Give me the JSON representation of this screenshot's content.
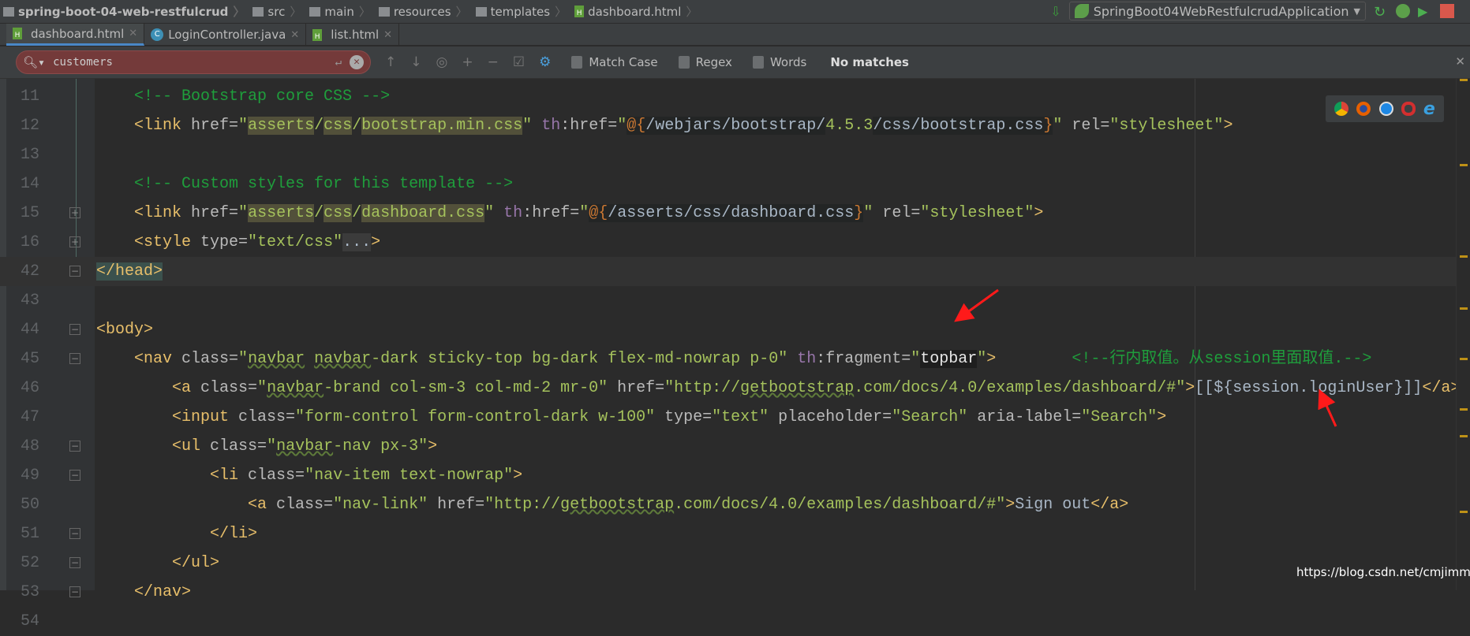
{
  "breadcrumb": [
    "spring-boot-04-web-restfulcrud",
    "src",
    "main",
    "resources",
    "templates",
    "dashboard.html"
  ],
  "run_config": "SpringBoot04WebRestfulcrudApplication",
  "tabs": [
    {
      "label": "dashboard.html",
      "icon": "html-file-icon",
      "active": true
    },
    {
      "label": "LoginController.java",
      "icon": "java-class-icon"
    },
    {
      "label": "list.html",
      "icon": "html-file-icon"
    }
  ],
  "find": {
    "query": "customers",
    "match_case": "Match Case",
    "regex": "Regex",
    "words": "Words",
    "status": "No matches"
  },
  "watermark": "https://blog.csdn.net/cmjimmy",
  "browsers": [
    "chrome",
    "firefox",
    "safari",
    "opera",
    "ie"
  ],
  "lines": [
    {
      "n": "11",
      "tokens": [
        [
          "plain",
          "    "
        ],
        [
          "cmt",
          "<!-- Bootstrap core CSS -->"
        ]
      ]
    },
    {
      "n": "12",
      "tokens": [
        [
          "plain",
          "    "
        ],
        [
          "tag",
          "<link "
        ],
        [
          "attr",
          "href="
        ],
        [
          "str",
          "\""
        ],
        [
          "hl",
          "asserts"
        ],
        [
          "str",
          "/"
        ],
        [
          "hl",
          "css"
        ],
        [
          "str",
          "/"
        ],
        [
          "hl",
          "bootstrap.min.css"
        ],
        [
          "str",
          "\" "
        ],
        [
          "th",
          "th"
        ],
        [
          "attr",
          ":href="
        ],
        [
          "str",
          "\""
        ],
        [
          "at",
          "@{"
        ],
        [
          "expr",
          "/webjars/bootstrap/"
        ],
        [
          "str",
          "4.5.3"
        ],
        [
          "expr",
          "/css/bootstrap.css"
        ],
        [
          "at",
          "}"
        ],
        [
          "str",
          "\" "
        ],
        [
          "attr",
          "rel="
        ],
        [
          "str",
          "\"stylesheet\""
        ],
        [
          "tag",
          ">"
        ]
      ]
    },
    {
      "n": "13",
      "tokens": []
    },
    {
      "n": "14",
      "tokens": [
        [
          "plain",
          "    "
        ],
        [
          "cmt",
          "<!-- Custom styles for this template -->"
        ]
      ]
    },
    {
      "n": "15",
      "tokens": [
        [
          "plain",
          "    "
        ],
        [
          "tag",
          "<link "
        ],
        [
          "attr",
          "href="
        ],
        [
          "str",
          "\""
        ],
        [
          "hl",
          "asserts"
        ],
        [
          "str",
          "/"
        ],
        [
          "hl",
          "css"
        ],
        [
          "str",
          "/"
        ],
        [
          "hl",
          "dashboard.css"
        ],
        [
          "str",
          "\" "
        ],
        [
          "th",
          "th"
        ],
        [
          "attr",
          ":href="
        ],
        [
          "str",
          "\""
        ],
        [
          "at",
          "@{"
        ],
        [
          "expr",
          "/asserts/css/dashboard.css"
        ],
        [
          "at",
          "}"
        ],
        [
          "str",
          "\" "
        ],
        [
          "attr",
          "rel="
        ],
        [
          "str",
          "\"stylesheet\""
        ],
        [
          "tag",
          ">"
        ]
      ],
      "fold": "+"
    },
    {
      "n": "16",
      "tokens": [
        [
          "plain",
          "    "
        ],
        [
          "tag",
          "<style "
        ],
        [
          "attr",
          "type="
        ],
        [
          "str",
          "\"text/css\""
        ],
        [
          "dim",
          "..."
        ],
        [
          "tag",
          ">"
        ]
      ],
      "fold": "+"
    },
    {
      "n": "42",
      "tokens": [
        [
          "headhl",
          "</head>"
        ]
      ],
      "fold": "-",
      "current": true
    },
    {
      "n": "43",
      "tokens": []
    },
    {
      "n": "44",
      "tokens": [
        [
          "tag",
          "<body>"
        ]
      ],
      "fold": "-"
    },
    {
      "n": "45",
      "tokens": [
        [
          "plain",
          "    "
        ],
        [
          "tag",
          "<nav "
        ],
        [
          "attr",
          "class="
        ],
        [
          "str",
          "\""
        ],
        [
          "wavy",
          "navbar"
        ],
        [
          "str",
          " "
        ],
        [
          "wavy",
          "navbar"
        ],
        [
          "str",
          "-dark sticky-top bg-dark flex-md-nowrap p-0\" "
        ],
        [
          "th",
          "th"
        ],
        [
          "attr",
          ":fragment="
        ],
        [
          "str",
          "\""
        ],
        [
          "box",
          "topbar"
        ],
        [
          "str",
          "\""
        ],
        [
          "tag",
          ">"
        ],
        [
          "plain",
          "        "
        ],
        [
          "cmt",
          "<!--行内取值。从session里面取值.-->"
        ]
      ],
      "fold": "-"
    },
    {
      "n": "46",
      "tokens": [
        [
          "plain",
          "        "
        ],
        [
          "tag",
          "<a "
        ],
        [
          "attr",
          "class="
        ],
        [
          "str",
          "\""
        ],
        [
          "wavy",
          "navbar"
        ],
        [
          "str",
          "-brand col-sm-3 col-md-2 mr-0\" "
        ],
        [
          "attr",
          "href="
        ],
        [
          "str",
          "\"http://"
        ],
        [
          "wavy",
          "getbootstrap"
        ],
        [
          "str",
          ".com/docs/4.0/examples/dashboard/#\""
        ],
        [
          "tag",
          ">"
        ],
        [
          "plain",
          "[[${session.loginUser}]]"
        ],
        [
          "tag",
          "</a>"
        ]
      ]
    },
    {
      "n": "47",
      "tokens": [
        [
          "plain",
          "        "
        ],
        [
          "tag",
          "<input "
        ],
        [
          "attr",
          "class="
        ],
        [
          "str",
          "\"form-control form-control-dark w-100\" "
        ],
        [
          "attr",
          "type="
        ],
        [
          "str",
          "\"text\" "
        ],
        [
          "attr",
          "placeholder="
        ],
        [
          "str",
          "\"Search\" "
        ],
        [
          "attr",
          "aria-label="
        ],
        [
          "str",
          "\"Search\""
        ],
        [
          "tag",
          ">"
        ]
      ]
    },
    {
      "n": "48",
      "tokens": [
        [
          "plain",
          "        "
        ],
        [
          "tag",
          "<ul "
        ],
        [
          "attr",
          "class="
        ],
        [
          "str",
          "\""
        ],
        [
          "wavy",
          "navbar"
        ],
        [
          "str",
          "-nav px-3\""
        ],
        [
          "tag",
          ">"
        ]
      ],
      "fold": "-"
    },
    {
      "n": "49",
      "tokens": [
        [
          "plain",
          "            "
        ],
        [
          "tag",
          "<li "
        ],
        [
          "attr",
          "class="
        ],
        [
          "str",
          "\"nav-item text-nowrap\""
        ],
        [
          "tag",
          ">"
        ]
      ],
      "fold": "-"
    },
    {
      "n": "50",
      "tokens": [
        [
          "plain",
          "                "
        ],
        [
          "tag",
          "<a "
        ],
        [
          "attr",
          "class="
        ],
        [
          "str",
          "\"nav-link\" "
        ],
        [
          "attr",
          "href="
        ],
        [
          "str",
          "\"http://"
        ],
        [
          "wavy",
          "getbootstrap"
        ],
        [
          "str",
          ".com/docs/4.0/examples/dashboard/#\""
        ],
        [
          "tag",
          ">"
        ],
        [
          "plain",
          "Sign out"
        ],
        [
          "tag",
          "</a>"
        ]
      ]
    },
    {
      "n": "51",
      "tokens": [
        [
          "plain",
          "            "
        ],
        [
          "tag",
          "</li>"
        ]
      ],
      "fold": "-"
    },
    {
      "n": "52",
      "tokens": [
        [
          "plain",
          "        "
        ],
        [
          "tag",
          "</ul>"
        ]
      ],
      "fold": "-"
    },
    {
      "n": "53",
      "tokens": [
        [
          "plain",
          "    "
        ],
        [
          "tag",
          "</nav>"
        ]
      ],
      "fold": "-"
    },
    {
      "n": "54",
      "tokens": []
    }
  ]
}
